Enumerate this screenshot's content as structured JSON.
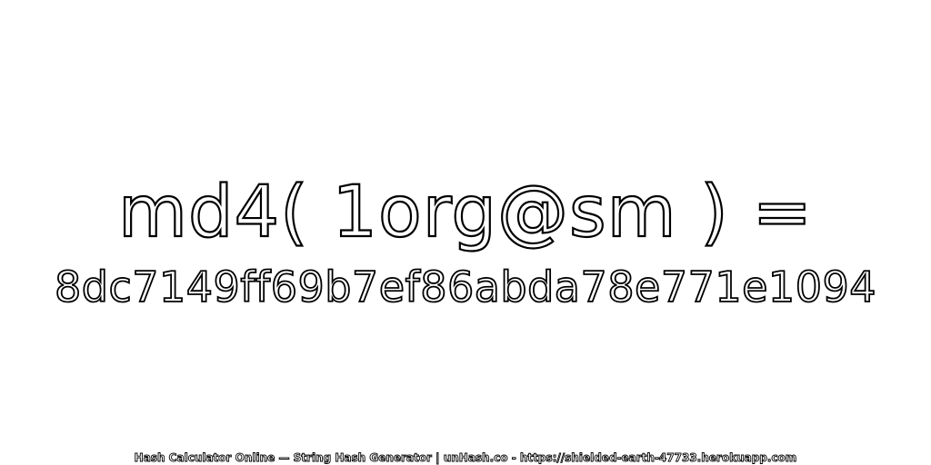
{
  "headline": "md4( 1org@sm ) =",
  "hash_value": "8dc7149ff69b7ef86abda78e771e1094",
  "footer": "Hash Calculator Online — String Hash Generator | unHash.co - https://shielded-earth-47733.herokuapp.com"
}
